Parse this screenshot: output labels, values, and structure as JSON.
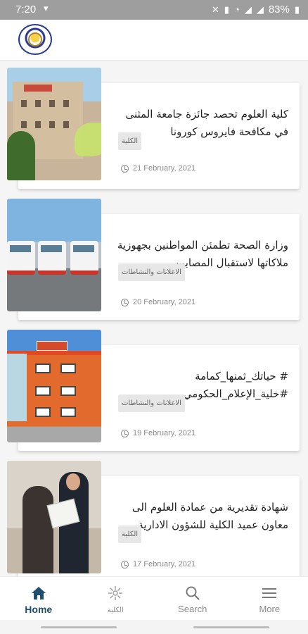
{
  "status_bar": {
    "time": "7:20",
    "battery": "83%"
  },
  "app": {
    "logo_icon": "college-logo"
  },
  "posts": [
    {
      "title": "كلية العلوم تحصد جائزة جامعة المثنى في مكافحة فايروس كورونا",
      "tag": "الكلية",
      "date": "21 February, 2021",
      "image": "college-building-photo"
    },
    {
      "title": "وزارة الصحة تطمئن المواطنين بجهوزية ملاكاتها لاستقبال المصابين",
      "tag": "الاعلانات والنشاطات",
      "date": "20 February, 2021",
      "image": "ambulances-photo"
    },
    {
      "title": "# حياتك_ثمنها_كمامة #خلية_الإعلام_الحكومي",
      "tag": "الاعلانات والنشاطات",
      "date": "19 February, 2021",
      "image": "orange-building-photo"
    },
    {
      "title": "شهادة تقديرية من عمادة العلوم الى معاون عميد الكلية للشؤون الادارية.",
      "tag": "الكلية",
      "date": "17 February, 2021",
      "image": "certificate-ceremony-photo"
    }
  ],
  "bottom_nav": {
    "items": [
      {
        "label": "Home",
        "icon": "home-icon",
        "active": true
      },
      {
        "label": "الكلية",
        "icon": "college-icon",
        "active": false
      },
      {
        "label": "Search",
        "icon": "search-icon",
        "active": false
      },
      {
        "label": "More",
        "icon": "menu-icon",
        "active": false
      }
    ]
  },
  "colors": {
    "accent": "#1f4e6e",
    "status_bar": "#9e9e9e",
    "feed_background": "#f5f5f5"
  }
}
